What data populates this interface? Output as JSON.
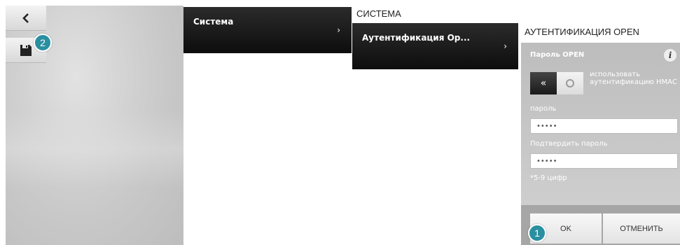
{
  "menu": {
    "col1_item": "Система",
    "col2_title": "СИСТЕМА",
    "col2_item": "Аутентификация Op...",
    "chevron": "›"
  },
  "panel": {
    "title": "АУТЕНТИФИКАЦИЯ OPEN",
    "field_heading": "Пароль OPEN",
    "info_icon_glyph": "i",
    "toggle_glyph": "«",
    "toggle_label": "использовать аутентификацию HMAC",
    "password_label": "пароль",
    "password_value": "•••••",
    "confirm_label": "Подтвердить пароль",
    "confirm_value": "•••••",
    "hint": "*5-9 цифр",
    "ok_label": "OK",
    "cancel_label": "ОТМЕНИТЬ"
  },
  "callouts": {
    "save": "2",
    "ok": "1"
  },
  "icons": {
    "back": "chevron-left-icon",
    "save": "floppy-disk-icon",
    "info": "info-icon",
    "toggle": "double-chevron-left-icon"
  },
  "colors": {
    "menu_bg": "#111111",
    "panel_bg": "#c6c6c6",
    "callout": "#2a8fa0"
  }
}
